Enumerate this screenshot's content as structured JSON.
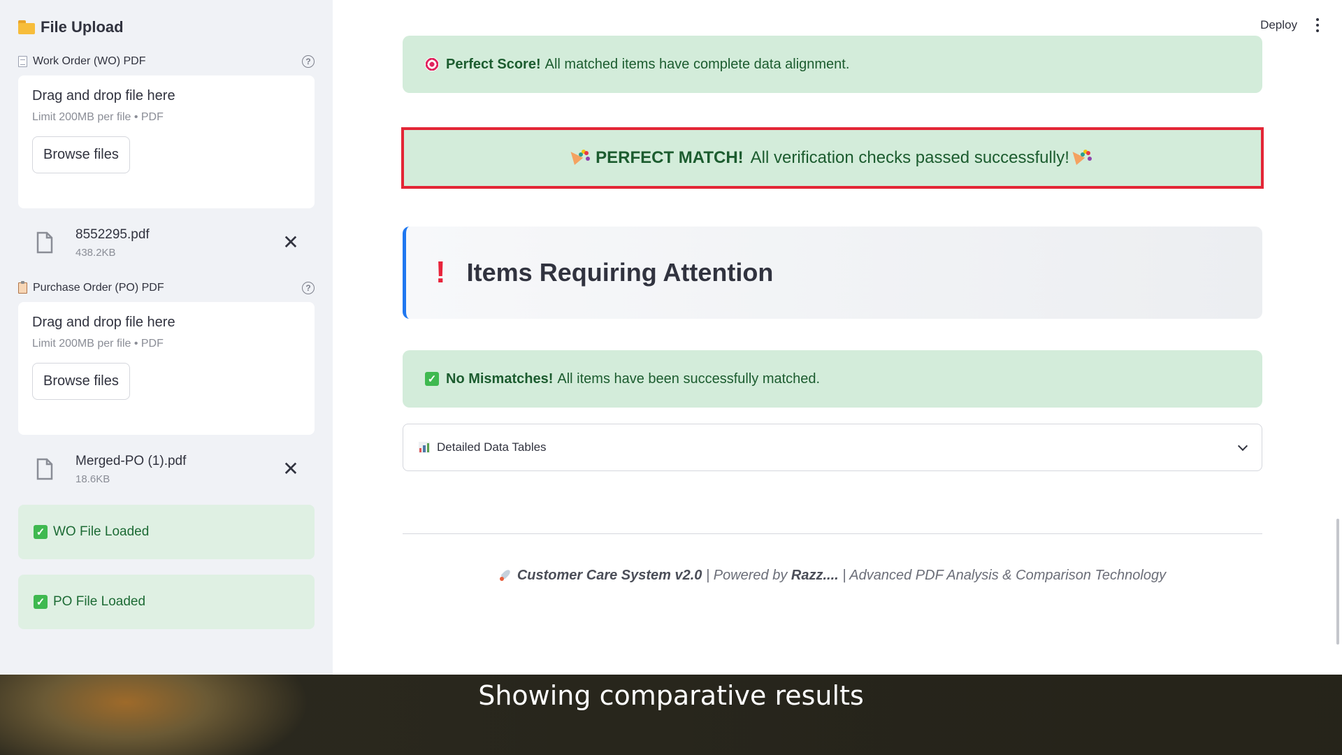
{
  "sidebar": {
    "title": "File Upload",
    "wo": {
      "label": "Work Order (WO) PDF",
      "dropzone_title": "Drag and drop file here",
      "dropzone_limit": "Limit 200MB per file • PDF",
      "browse_label": "Browse files",
      "file_name": "8552295.pdf",
      "file_size": "438.2KB"
    },
    "po": {
      "label": "Purchase Order (PO) PDF",
      "dropzone_title": "Drag and drop file here",
      "dropzone_limit": "Limit 200MB per file • PDF",
      "browse_label": "Browse files",
      "file_name": "Merged-PO (1).pdf",
      "file_size": "18.6KB"
    },
    "status": {
      "wo_loaded": "WO File Loaded",
      "po_loaded": "PO File Loaded"
    }
  },
  "header": {
    "deploy_label": "Deploy"
  },
  "main": {
    "perfect_score": {
      "bold": "Perfect Score!",
      "text": "All matched items have complete data alignment."
    },
    "perfect_match": {
      "bold": "PERFECT MATCH!",
      "text": "All verification checks passed successfully!"
    },
    "attention_title": "Items Requiring Attention",
    "no_mismatch": {
      "bold": "No Mismatches!",
      "text": "All items have been successfully matched."
    },
    "expander_label": "Detailed Data Tables",
    "footer": {
      "system": "Customer Care System v2.0",
      "sep1": " | Powered by ",
      "author": "Razz....",
      "sep2": " | Advanced PDF Analysis & Comparison Technology"
    }
  },
  "caption": "Showing comparative results",
  "colors": {
    "success_bg": "#d3ecda",
    "success_text": "#1c5c2f",
    "highlight_border": "#e32636",
    "accent_blue": "#1f77f0",
    "sidebar_bg": "#f0f2f6"
  }
}
